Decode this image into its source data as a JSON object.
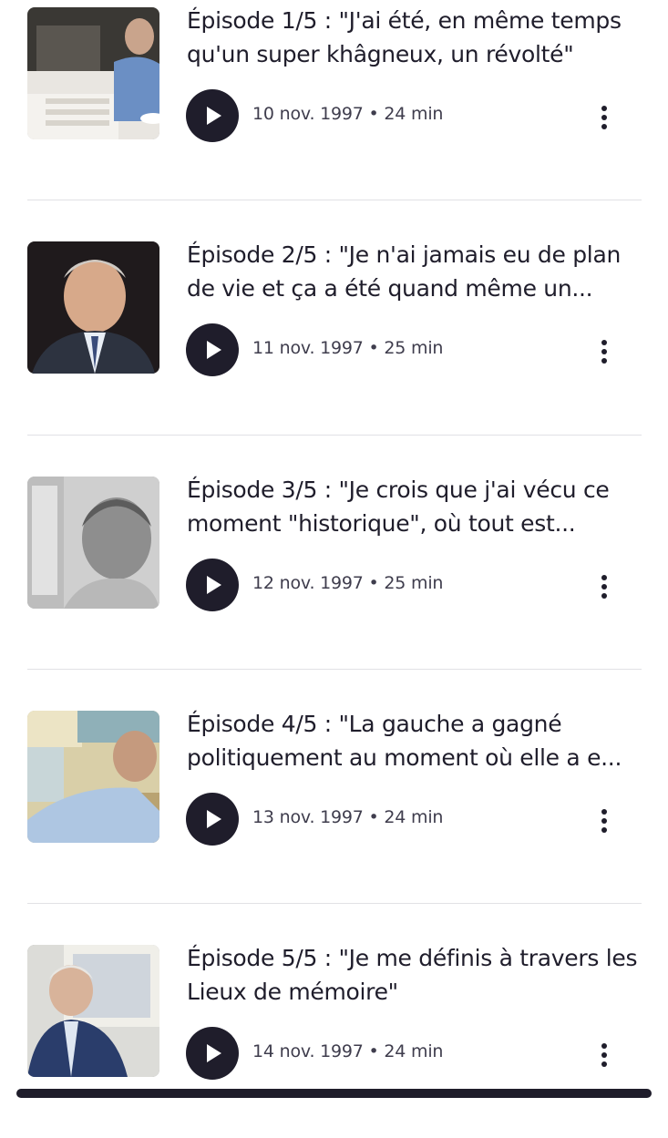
{
  "episodes": [
    {
      "title": "Épisode 1/5 : \"J'ai été, en même temps qu'un super khâgneux, un révolté\"",
      "date": "10 nov. 1997",
      "separator": "•",
      "duration": "24 min",
      "thumb_icon": "portrait-photo"
    },
    {
      "title": "Épisode 2/5 : \"Je n'ai jamais eu de plan de vie et ça a été quand même un...",
      "date": "11 nov. 1997",
      "separator": "•",
      "duration": "25 min",
      "thumb_icon": "portrait-photo"
    },
    {
      "title": "Épisode 3/5 : \"Je crois que j'ai vécu ce moment \"historique\", où tout est...",
      "date": "12 nov. 1997",
      "separator": "•",
      "duration": "25 min",
      "thumb_icon": "portrait-photo"
    },
    {
      "title": "Épisode 4/5 : \"La gauche a gagné politiquement au moment où elle a e...",
      "date": "13 nov. 1997",
      "separator": "•",
      "duration": "24 min",
      "thumb_icon": "portrait-photo"
    },
    {
      "title": "Épisode 5/5 : \"Je me définis à travers les Lieux de mémoire\"",
      "date": "14 nov. 1997",
      "separator": "•",
      "duration": "24 min",
      "thumb_icon": "portrait-photo"
    }
  ],
  "colors": {
    "text": "#1f1d2b",
    "meta": "#3f3d4d",
    "play_bg": "#1f1d2b",
    "divider": "#e1e1e5"
  }
}
